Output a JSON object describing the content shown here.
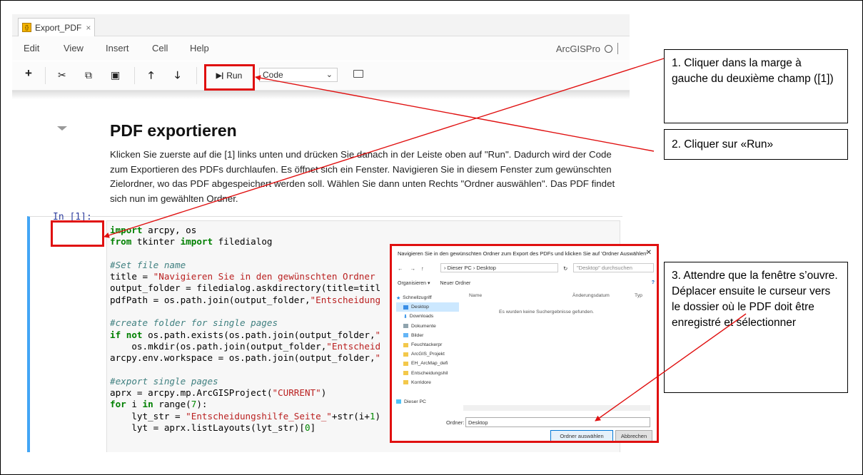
{
  "notebook": {
    "tab_label": "Export_PDF",
    "tab_icon_text": "{}",
    "tab_close": "×",
    "menu": [
      "Edit",
      "View",
      "Insert",
      "Cell",
      "Help"
    ],
    "kernel_name": "ArcGISPro",
    "toolbar": {
      "add": "+",
      "cut": "✂",
      "copy": "⧉",
      "paste": "▣",
      "up": "🡑",
      "down": "🡓",
      "run_label": "Run",
      "cell_type": "Code"
    },
    "markdown_title": "PDF exportieren",
    "markdown_text": "Klicken Sie zuerste auf die [1] links unten und drücken Sie danach in der Leiste oben auf \"Run\". Dadurch wird der Code zum Exportieren des PDFs durchlaufen. Es öffnet sich ein Fenster. Navigieren Sie in diesem Fenster zum gewünschten Zielordner, wo das PDF abgespeichert werden soll. Wählen Sie dann unten Rechts \"Ordner auswählen\". Das PDF findet sich nun im gewählten Ordner.",
    "cell_prompt": "In [1]:"
  },
  "callouts": {
    "step1": "1. Cliquer dans la marge à gauche du deuxième champ ([1])",
    "step2": "2. Cliquer sur «Run»",
    "step3": "3. Attendre que la fenêtre s’ouvre. Déplacer ensuite le curseur vers le dossier où le PDF doit être enregistré et sélectionner"
  },
  "dialog": {
    "title": "Navigieren Sie in den gewünschten Ordner zum Export des PDFs und klicken Sie auf 'Ordner Auswählen'",
    "close": "✕",
    "path": "› Dieser PC › Desktop",
    "search_placeholder": "\"Desktop\" durchsuchen",
    "organize": "Organisieren ▾",
    "new_folder": "Neuer Ordner",
    "columns": [
      "Name",
      "Änderungsdatum",
      "Typ"
    ],
    "empty_message": "Es wurden keine Suchergebnisse gefunden.",
    "sidebar": [
      "Schnellzugriff",
      "Desktop",
      "Downloads",
      "Dokumente",
      "Bilder",
      "Feuchtackerpr",
      "ArcGIS_Projekt",
      "EH_ArcMap_defi",
      "Entscheidungshil",
      "Korridore",
      "Dieser PC"
    ],
    "folder_label": "Ordner:",
    "folder_value": "Desktop",
    "ok_button": "Ordner auswählen",
    "cancel_button": "Abbrechen"
  },
  "colors": {
    "highlight": "#e01010",
    "cell_border": "#42a5f5",
    "prompt": "#303f9f"
  }
}
